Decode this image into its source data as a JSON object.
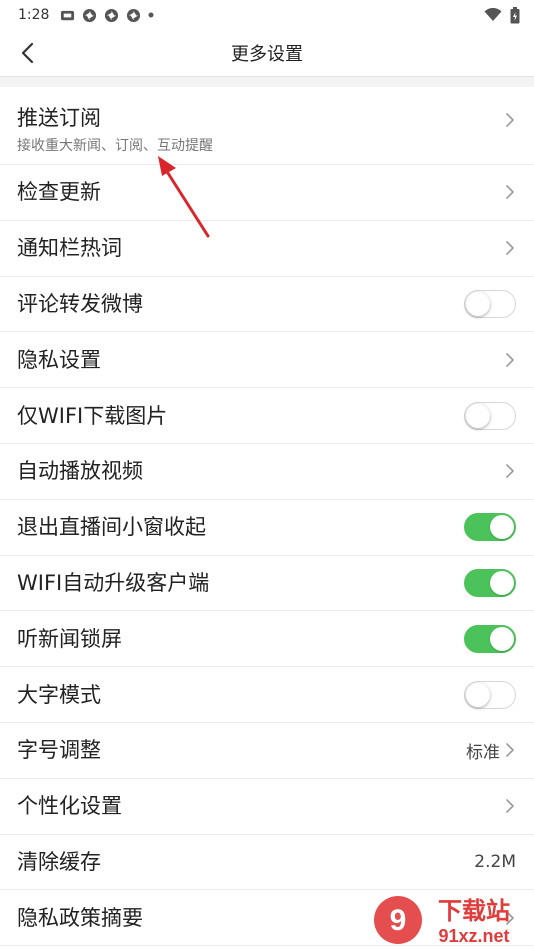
{
  "status_bar": {
    "time": "1:28",
    "left_icons": [
      "app-badge-icon",
      "pinwheel-icon",
      "pinwheel-icon",
      "pinwheel-icon",
      "dot-icon"
    ],
    "right_icons": [
      "wifi-icon",
      "battery-icon"
    ]
  },
  "header": {
    "title": "更多设置",
    "back_icon": "back-chevron-icon"
  },
  "settings": [
    {
      "label": "推送订阅",
      "sub": "接收重大新闻、订阅、互动提醒",
      "control": "chevron"
    },
    {
      "label": "检查更新",
      "control": "chevron"
    },
    {
      "label": "通知栏热词",
      "control": "chevron"
    },
    {
      "label": "评论转发微博",
      "control": "toggle",
      "on": false
    },
    {
      "label": "隐私设置",
      "control": "chevron"
    },
    {
      "label": "仅WIFI下载图片",
      "control": "toggle",
      "on": false
    },
    {
      "label": "自动播放视频",
      "control": "chevron"
    },
    {
      "label": "退出直播间小窗收起",
      "control": "toggle",
      "on": true
    },
    {
      "label": "WIFI自动升级客户端",
      "control": "toggle",
      "on": true
    },
    {
      "label": "听新闻锁屏",
      "control": "toggle",
      "on": true
    },
    {
      "label": "大字模式",
      "control": "toggle",
      "on": false
    },
    {
      "label": "字号调整",
      "value": "标准",
      "control": "chevron"
    },
    {
      "label": "个性化设置",
      "control": "chevron"
    },
    {
      "label": "清除缓存",
      "value": "2.2M",
      "control": "none"
    },
    {
      "label": "隐私政策摘要",
      "control": "chevron"
    }
  ],
  "colors": {
    "toggle_on": "#4cc35a",
    "annotation_arrow": "#d9262b"
  },
  "watermark": {
    "brand": "下载站",
    "url": "91xz.net",
    "logo_text": "9"
  }
}
